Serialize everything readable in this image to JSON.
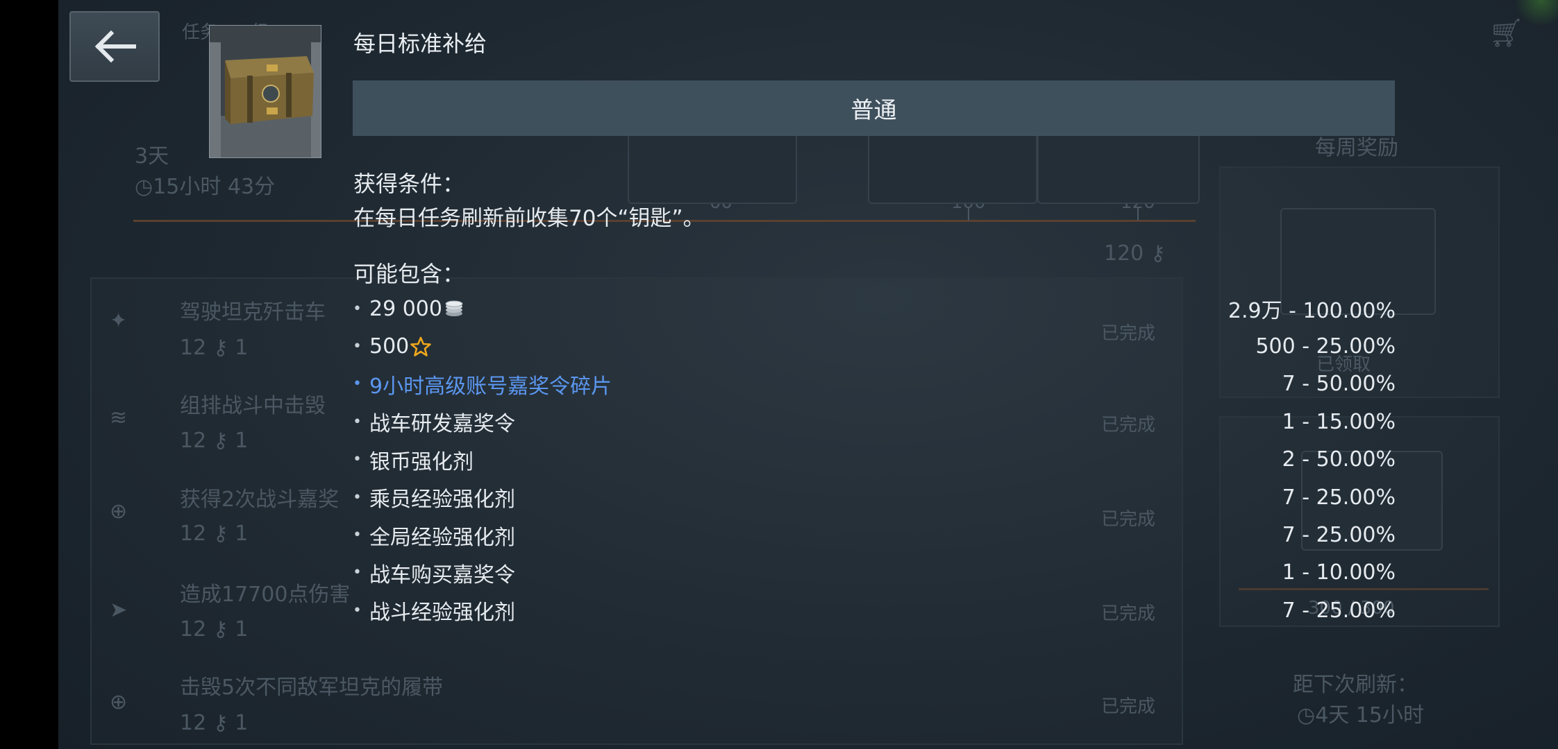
{
  "background": {
    "breadcrumb": "任务 / III级",
    "timer_days": "3天",
    "timer_time": "15小时 43分",
    "progress_ticks": [
      "00",
      "100",
      "120"
    ],
    "progress_total": "120",
    "weekly_reward_label": "每周奖励",
    "missions": [
      {
        "text": "驾驶坦克歼击车",
        "reward_keys": "12",
        "reward_count": "1",
        "status": "已完成"
      },
      {
        "text": "组排战斗中击毁",
        "reward_keys": "12",
        "reward_count": "1",
        "status": "已完成"
      },
      {
        "text": "获得2次战斗嘉奖",
        "reward_keys": "12",
        "reward_count": "1",
        "status": "已完成"
      },
      {
        "text": "造成17700点伤害",
        "reward_keys": "12",
        "reward_count": "1",
        "status": "已完成"
      },
      {
        "text": "击毁5次不同敌军坦克的履带",
        "reward_keys": "12",
        "reward_count": "1",
        "status": "已完成"
      }
    ],
    "claimed_label": "已领取",
    "weekly_progress": "300 / 300",
    "next_refresh_label": "距下次刷新：",
    "next_refresh_time": "4天 15小时"
  },
  "popup": {
    "title": "每日标准补给",
    "tier": "普通",
    "condition_label": "获得条件：",
    "condition_text": "在每日任务刷新前收集70个“钥匙”。",
    "contents_label": "可能包含：",
    "items": [
      {
        "name": "29 000",
        "icon": "silver-coin-icon",
        "chance": "2.9万 - 100.00%",
        "link": false
      },
      {
        "name": "500",
        "icon": "gold-star-icon",
        "chance": "500 - 25.00%",
        "link": false
      },
      {
        "name": "9小时高级账号嘉奖令碎片",
        "icon": "",
        "chance": "7 - 50.00%",
        "link": true
      },
      {
        "name": "战车研发嘉奖令",
        "icon": "",
        "chance": "1 - 15.00%",
        "link": false
      },
      {
        "name": "银币强化剂",
        "icon": "",
        "chance": "2 - 50.00%",
        "link": false
      },
      {
        "name": "乘员经验强化剂",
        "icon": "",
        "chance": "7 - 25.00%",
        "link": false
      },
      {
        "name": "全局经验强化剂",
        "icon": "",
        "chance": "7 - 25.00%",
        "link": false
      },
      {
        "name": "战车购买嘉奖令",
        "icon": "",
        "chance": "1 - 10.00%",
        "link": false
      },
      {
        "name": "战斗经验强化剂",
        "icon": "",
        "chance": "7 - 25.00%",
        "link": false
      }
    ]
  },
  "colors": {
    "accent_link": "#5b97f0",
    "tier_bar": "#3f505d",
    "star": "#f0a81c"
  }
}
